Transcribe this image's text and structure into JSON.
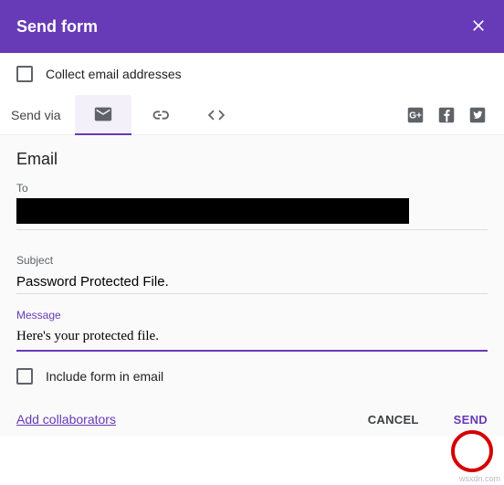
{
  "header": {
    "title": "Send form"
  },
  "collect": {
    "label": "Collect email addresses"
  },
  "sendvia": {
    "label": "Send via"
  },
  "email": {
    "section_title": "Email",
    "to_label": "To",
    "subject_label": "Subject",
    "subject_value": "Password Protected File.",
    "message_label": "Message",
    "message_value": "Here's your protected file.",
    "include_label": "Include form in email"
  },
  "footer": {
    "add_collaborators": "Add collaborators",
    "cancel": "CANCEL",
    "send": "SEND"
  },
  "watermark": "wsxdn.com"
}
